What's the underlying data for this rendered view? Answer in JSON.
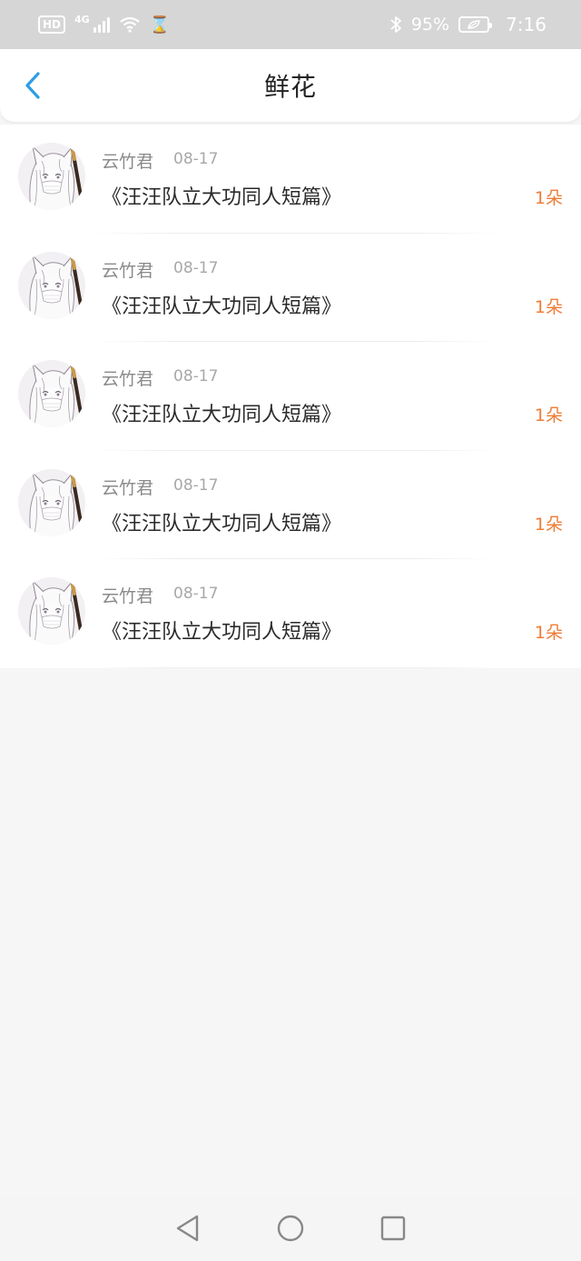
{
  "status_bar": {
    "hd": "HD",
    "network": "4G",
    "battery_pct": "95%",
    "time": "7:16"
  },
  "header": {
    "title": "鲜花"
  },
  "items": [
    {
      "username": "云竹君",
      "date": "08-17",
      "title": "《汪汪队立大功同人短篇》",
      "count": "1朵"
    },
    {
      "username": "云竹君",
      "date": "08-17",
      "title": "《汪汪队立大功同人短篇》",
      "count": "1朵"
    },
    {
      "username": "云竹君",
      "date": "08-17",
      "title": "《汪汪队立大功同人短篇》",
      "count": "1朵"
    },
    {
      "username": "云竹君",
      "date": "08-17",
      "title": "《汪汪队立大功同人短篇》",
      "count": "1朵"
    },
    {
      "username": "云竹君",
      "date": "08-17",
      "title": "《汪汪队立大功同人短篇》",
      "count": "1朵"
    }
  ],
  "colors": {
    "accent_blue": "#2f9de4",
    "count_orange": "#ee7d36"
  },
  "icons": {
    "back": "chevron-left-icon",
    "nav_back": "triangle-back-icon",
    "nav_home": "circle-home-icon",
    "nav_recents": "square-recents-icon"
  }
}
